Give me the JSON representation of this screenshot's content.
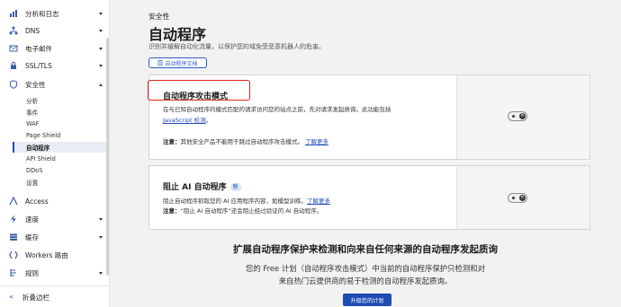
{
  "sidebar": {
    "items": [
      {
        "label": "分析和日志",
        "icon": "chart-icon",
        "chevron": "down"
      },
      {
        "label": "DNS",
        "icon": "dns-icon",
        "chevron": "down"
      },
      {
        "label": "电子邮件",
        "icon": "email-icon",
        "chevron": "down"
      },
      {
        "label": "SSL/TLS",
        "icon": "lock-icon",
        "chevron": "down"
      },
      {
        "label": "安全性",
        "icon": "shield-icon",
        "chevron": "up"
      }
    ],
    "security_sub": [
      {
        "label": "分析"
      },
      {
        "label": "事件"
      },
      {
        "label": "WAF"
      },
      {
        "label": "Page Shield"
      },
      {
        "label": "自动程序",
        "active": true
      },
      {
        "label": "API Shield"
      },
      {
        "label": "DDoS"
      },
      {
        "label": "设置"
      }
    ],
    "items_after": [
      {
        "label": "Access",
        "icon": "access-icon"
      },
      {
        "label": "速度",
        "icon": "speed-icon",
        "chevron": "down"
      },
      {
        "label": "缓存",
        "icon": "cache-icon",
        "chevron": "down"
      },
      {
        "label": "Workers 路由",
        "icon": "workers-icon"
      },
      {
        "label": "规则",
        "icon": "rules-icon",
        "chevron": "down"
      }
    ],
    "collapse_label": "折叠边栏"
  },
  "header": {
    "breadcrumb": "安全性",
    "title": "自动程序",
    "description": "识别并缓解自动化流量，以保护您的域免受恶意机器人的危害。",
    "doc_button": "自动程序文档"
  },
  "card_fight_mode": {
    "title": "自动程序攻击模式",
    "line1": "在与已知自动程序的模式匹配的请求访问您的站点之前，先对请求发起质询。此功能包括",
    "line2_link": "JavaScript 检测",
    "line2_suffix": "。",
    "note_label": "注意：",
    "note_text": "其他安全产品不能用于跳过自动程序攻击模式。",
    "note_link": "了解更多",
    "toggle_state": "off"
  },
  "card_block_ai": {
    "title": "阻止 AI 自动程序",
    "badge": "新",
    "line1": "阻止自动程序抓取您的 AI 应用程序内容，如模型训练。",
    "line1_link": "了解更多",
    "note_label": "注意：",
    "note_text": "“阻止 AI 自动程序”还会阻止经过验证的 AI 自动程序。",
    "toggle_state": "off"
  },
  "upsell": {
    "title": "扩展自动程序保护来检测和向来自任何来源的自动程序发起质询",
    "line1": "您的 Free 计划（自动程序攻击模式）中当前的自动程序保护只检测和对",
    "line2": "来自热门云提供商的易于检测的自动程序发起质询。",
    "button": "升级您的计划"
  }
}
